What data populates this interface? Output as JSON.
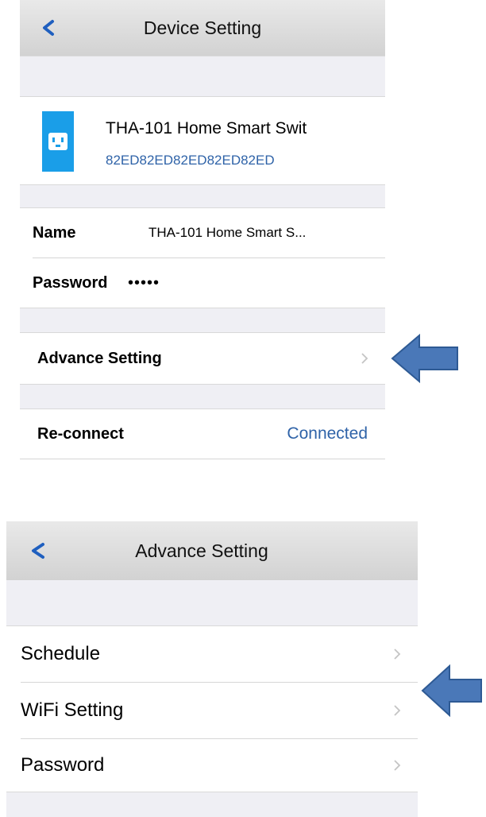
{
  "screen1": {
    "nav": {
      "title": "Device Setting"
    },
    "device": {
      "name": "THA-101 Home Smart Swit",
      "id": "82ED82ED82ED82ED82ED"
    },
    "fields": {
      "name_label": "Name",
      "name_value": "THA-101 Home Smart S...",
      "password_label": "Password",
      "password_value": "•••••"
    },
    "advance_label": "Advance Setting",
    "reconnect": {
      "label": "Re-connect",
      "status": "Connected"
    }
  },
  "screen2": {
    "nav": {
      "title": "Advance Setting"
    },
    "items": [
      {
        "label": "Schedule"
      },
      {
        "label": "WiFi Setting"
      },
      {
        "label": "Password"
      }
    ]
  },
  "colors": {
    "accent_blue": "#1f5fbf",
    "status_blue": "#2f63a8",
    "pointer_arrow": "#4a78b8",
    "device_icon": "#1a9ee8"
  },
  "icons": {
    "back": "chevron-left-icon",
    "device": "smart-plug-icon",
    "row_chevron": "chevron-right-icon",
    "pointer": "pointer-arrow-icon"
  }
}
